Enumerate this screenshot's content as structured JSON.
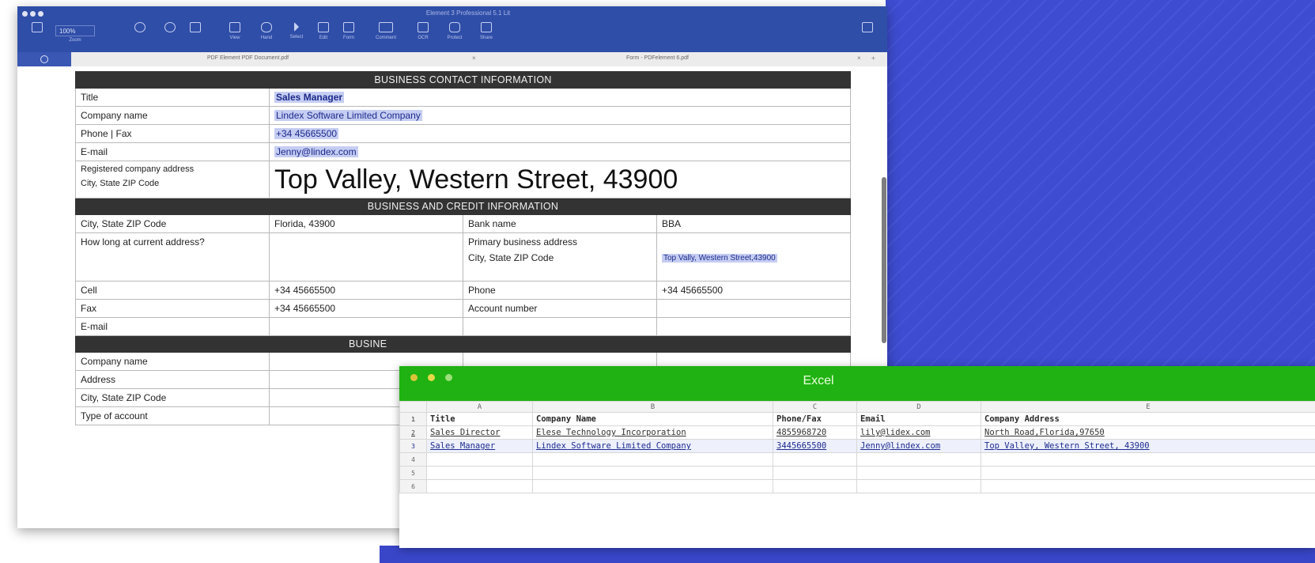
{
  "pdf_app": {
    "window_title": "Element 3 Professional 5.1 Lit",
    "zoom": {
      "value": "100%",
      "label": "Zoom"
    },
    "toolbar": [
      {
        "name": "view",
        "label": "View"
      },
      {
        "name": "hand",
        "label": "Hand"
      },
      {
        "name": "select",
        "label": "Select"
      },
      {
        "name": "edit",
        "label": "Edit"
      },
      {
        "name": "form",
        "label": "Form"
      },
      {
        "name": "comment",
        "label": "Comment"
      },
      {
        "name": "ocr",
        "label": "OCR"
      },
      {
        "name": "protect",
        "label": "Protect"
      },
      {
        "name": "share",
        "label": "Share"
      }
    ],
    "tabs": {
      "left_file": "PDF Element PDF Document.pdf",
      "right_file": "Form - PDFelement 6.pdf"
    }
  },
  "form": {
    "section1_title": "BUSINESS CONTACT INFORMATION",
    "title_label": "Title",
    "title_value": "Sales Manager",
    "company_label": "Company name",
    "company_value": "Lindex Software Limited Company",
    "phone_label": "Phone | Fax",
    "phone_value": "+34 45665500",
    "email_label": "E-mail",
    "email_value": "Jenny@lindex.com",
    "address_label_1": "Registered company address",
    "address_label_2": "City, State ZIP Code",
    "address_value": "Top Valley, Western Street, 43900",
    "section2_title": "BUSINESS AND CREDIT INFORMATION",
    "city_label": "City, State ZIP Code",
    "city_value": "Florida, 43900",
    "bank_label": "Bank name",
    "bank_value": "BBA",
    "howlong_label": "How long at current address?",
    "primary_label_1": "Primary business address",
    "primary_label_2": "City, State ZIP Code",
    "primary_value": "Top Vally, Western Street,43900",
    "cell_label": "Cell",
    "cell_value": "+34 45665500",
    "phone2_label": "Phone",
    "phone2_value": "+34 45665500",
    "fax_label": "Fax",
    "fax_value": "+34 45665500",
    "account_label": "Account number",
    "email2_label": "E-mail",
    "section3_title": "BUSINE",
    "company2_label": "Company name",
    "address2_label": "Address",
    "city2_label": "City, State ZIP Code",
    "type_label": "Type of account"
  },
  "excel": {
    "title": "Excel",
    "columns": [
      "A",
      "B",
      "C",
      "D",
      "E"
    ],
    "rows": [
      {
        "num": "1",
        "cells": [
          "Title",
          "Company Name",
          "Phone/Fax",
          "Email",
          "Company Address"
        ]
      },
      {
        "num": "2",
        "cells": [
          "Sales Director",
          "Elese Technology Incorporation",
          "4855968720",
          "lily@lidex.com",
          "North Road,Florida,97650"
        ]
      },
      {
        "num": "3",
        "cells": [
          "Sales Manager",
          "Lindex Software Limited Company",
          "3445665500",
          "Jenny@lindex.com",
          "Top Valley, Western Street, 43900"
        ]
      },
      {
        "num": "4",
        "cells": [
          "",
          "",
          "",
          "",
          ""
        ]
      },
      {
        "num": "5",
        "cells": [
          "",
          "",
          "",
          "",
          ""
        ]
      },
      {
        "num": "6",
        "cells": [
          "",
          "",
          "",
          "",
          ""
        ]
      }
    ]
  }
}
